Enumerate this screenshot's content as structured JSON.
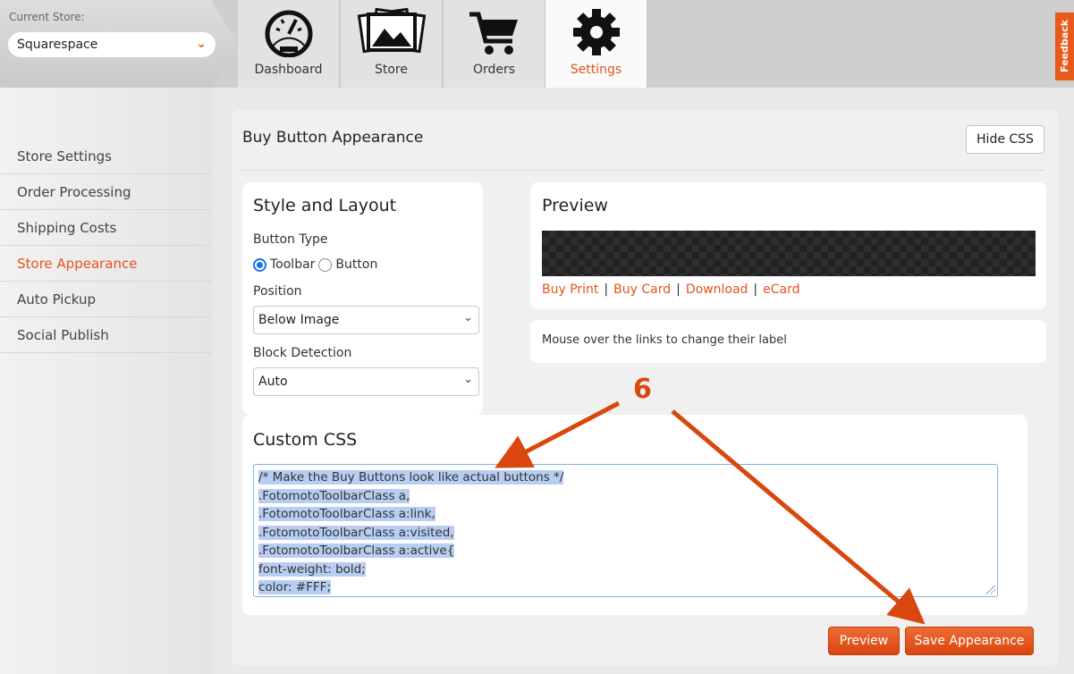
{
  "header": {
    "store_label": "Current Store:",
    "store_value": "Squarespace",
    "tabs": [
      {
        "label": "Dashboard",
        "icon": "gauge-icon"
      },
      {
        "label": "Store",
        "icon": "photos-icon"
      },
      {
        "label": "Orders",
        "icon": "cart-icon"
      },
      {
        "label": "Settings",
        "icon": "gear-icon"
      }
    ],
    "feedback": "Feedback"
  },
  "sidebar": {
    "items": [
      {
        "label": "Store Settings"
      },
      {
        "label": "Order Processing"
      },
      {
        "label": "Shipping Costs"
      },
      {
        "label": "Store Appearance"
      },
      {
        "label": "Auto Pickup"
      },
      {
        "label": "Social Publish"
      }
    ],
    "active": "Store Appearance"
  },
  "main": {
    "title": "Buy Button Appearance",
    "hide_css_label": "Hide CSS",
    "style_layout": {
      "title": "Style and Layout",
      "button_type_label": "Button Type",
      "option_toolbar": "Toolbar",
      "option_button": "Button",
      "selected_button_type": "Toolbar",
      "position_label": "Position",
      "position_value": "Below Image",
      "block_detection_label": "Block Detection",
      "block_detection_value": "Auto"
    },
    "preview": {
      "title": "Preview",
      "links": [
        "Buy Print",
        "Buy Card",
        "Download",
        "eCard"
      ],
      "separator": "|",
      "hint": "Mouse over the links to change their label"
    },
    "custom_css": {
      "title": "Custom CSS",
      "lines": [
        "/* Make the Buy Buttons look like actual buttons */",
        ".FotomotoToolbarClass a,",
        ".FotomotoToolbarClass a:link,",
        ".FotomotoToolbarClass a:visited,",
        ".FotomotoToolbarClass a:active{",
        "font-weight: bold;",
        "color: #FFF;"
      ]
    },
    "preview_button": "Preview",
    "save_button": "Save Appearance"
  },
  "annotation": {
    "number": "6",
    "color": "#d9470f"
  },
  "colors": {
    "accent": "#e5531a",
    "selection": "#b7cdf2"
  }
}
